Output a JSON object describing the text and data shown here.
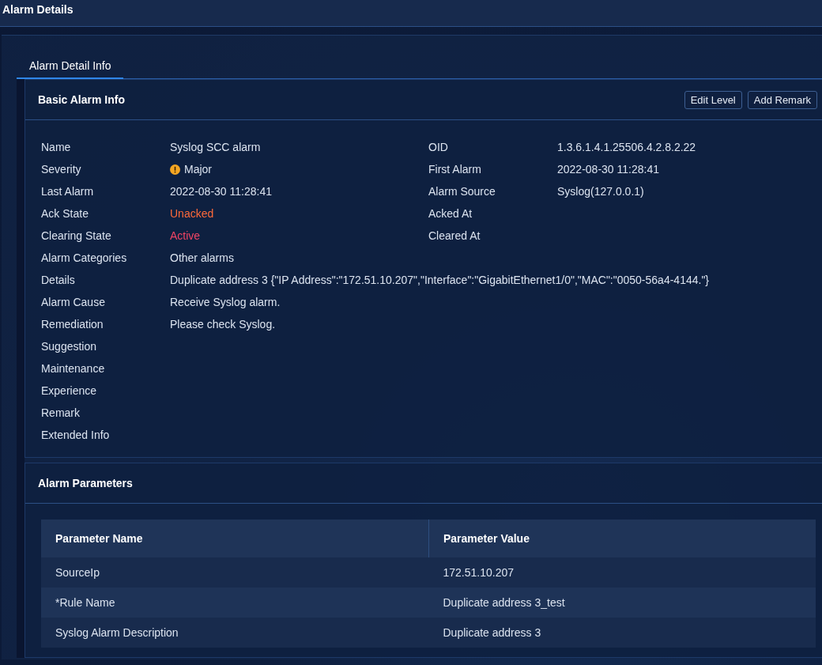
{
  "header": {
    "title": "Alarm Details"
  },
  "tabs": [
    {
      "label": "Alarm Detail Info",
      "selected": true
    }
  ],
  "basic_info": {
    "title": "Basic Alarm Info",
    "buttons": [
      "Edit Level",
      "Add Remark"
    ],
    "left_fields": [
      {
        "label": "Name",
        "value": "Syslog SCC alarm",
        "kind": "text"
      },
      {
        "label": "Severity",
        "value": "Major",
        "kind": "severity"
      },
      {
        "label": "Last Alarm",
        "value": "2022-08-30 11:28:41",
        "kind": "text"
      },
      {
        "label": "Ack State",
        "value": "Unacked",
        "kind": "warning"
      },
      {
        "label": "Clearing State",
        "value": "Active",
        "kind": "danger"
      },
      {
        "label": "Alarm Categories",
        "value": "Other alarms",
        "kind": "text"
      },
      {
        "label": "Details",
        "value": "Duplicate address 3 {\"IP Address\":\"172.51.10.207\",\"Interface\":\"GigabitEthernet1/0\",\"MAC\":\"0050-56a4-4144.\"}",
        "kind": "text"
      },
      {
        "label": "Alarm Cause",
        "value": "Receive Syslog alarm.",
        "kind": "text"
      },
      {
        "label": "Remediation",
        "value": "Please check Syslog.",
        "kind": "text"
      },
      {
        "label": "Suggestion"
      },
      {
        "label": "Maintenance"
      },
      {
        "label": "Experience"
      },
      {
        "label": "Remark"
      },
      {
        "label": "Extended Info"
      }
    ],
    "right_fields": [
      {
        "label": "OID",
        "value": "1.3.6.1.4.1.25506.4.2.8.2.22"
      },
      {
        "label": "First Alarm",
        "value": "2022-08-30 11:28:41"
      },
      {
        "label": "Alarm Source",
        "value": "Syslog(127.0.0.1)"
      },
      {
        "label": "Acked At"
      },
      {
        "label": "Cleared At"
      }
    ]
  },
  "parameters": {
    "title": "Alarm Parameters",
    "table": {
      "columns": [
        "Parameter Name",
        "Parameter Value"
      ],
      "rows": [
        [
          "SourceIp",
          "172.51.10.207"
        ],
        [
          "*Rule Name",
          "Duplicate address 3_test"
        ],
        [
          "Syslog Alarm Description",
          "Duplicate address 3"
        ]
      ]
    }
  }
}
